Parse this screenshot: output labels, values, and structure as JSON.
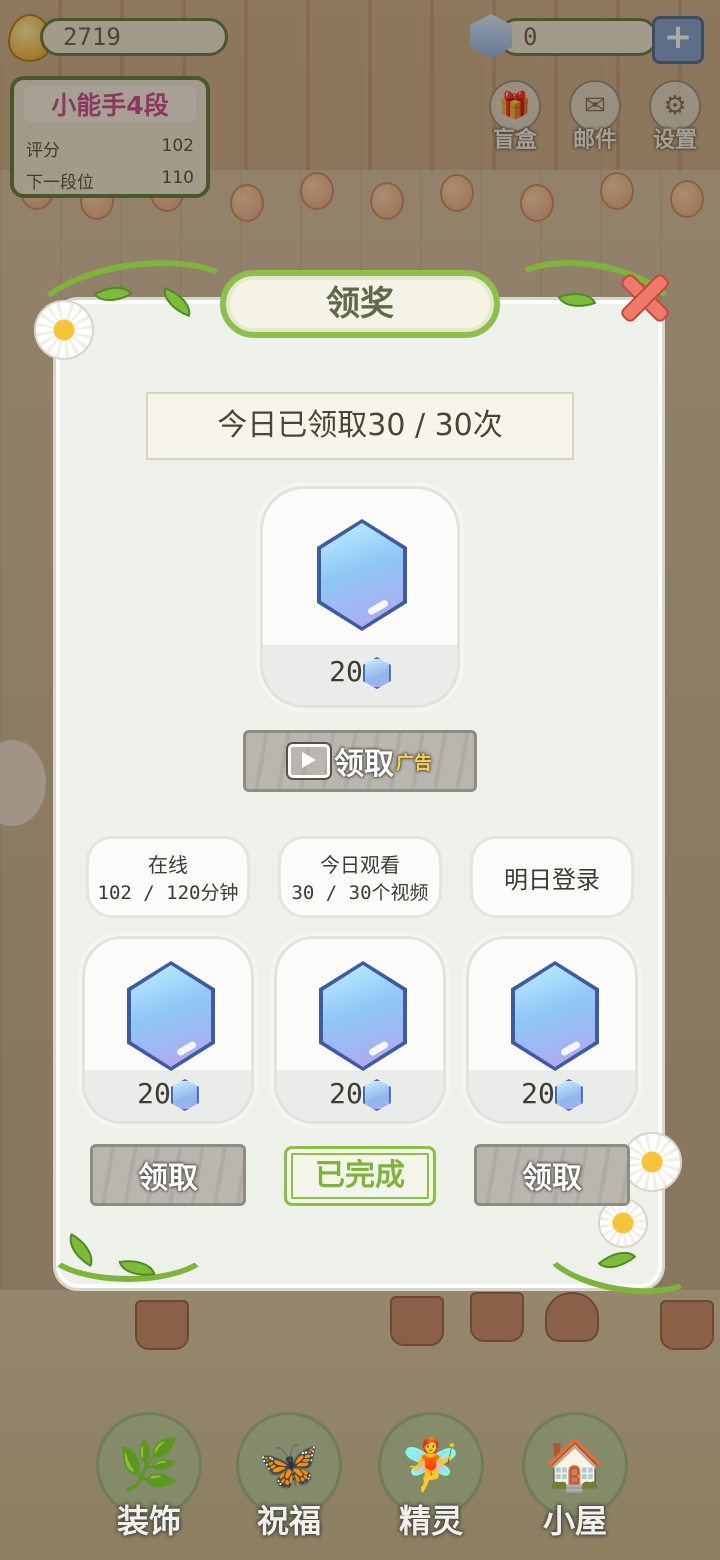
{
  "hud": {
    "coins": "2719",
    "gems": "0",
    "plus_icon": "plus-icon",
    "rank": {
      "title": "小能手4段",
      "score_label": "评分",
      "score_value": "102",
      "next_label": "下一段位",
      "next_value": "110"
    },
    "top_buttons": [
      {
        "label": "盲盒",
        "icon": "gift-box-icon"
      },
      {
        "label": "邮件",
        "icon": "mail-icon"
      },
      {
        "label": "设置",
        "icon": "gear-icon"
      }
    ]
  },
  "modal": {
    "title": "领奖",
    "daily_count": "今日已领取30 / 30次",
    "main_reward": {
      "amount": "20",
      "button_label": "领取",
      "ad_tag": "广告"
    },
    "tasks": [
      {
        "line1": "在线",
        "line2": "102 / 120分钟",
        "amount": "20",
        "button": "领取",
        "state": "claimable"
      },
      {
        "line1": "今日观看",
        "line2": "30 / 30个视频",
        "amount": "20",
        "button": "已完成",
        "state": "done"
      },
      {
        "line1": "明日登录",
        "line2": "",
        "amount": "20",
        "button": "领取",
        "state": "claimable"
      }
    ]
  },
  "nav": [
    {
      "label": "装饰",
      "icon": "plant-icon"
    },
    {
      "label": "祝福",
      "icon": "butterfly-icon"
    },
    {
      "label": "精灵",
      "icon": "fairy-icon"
    },
    {
      "label": "小屋",
      "icon": "house-icon"
    }
  ],
  "colors": {
    "accent_green": "#7fb43c",
    "close_red": "#f07a6a",
    "rank_pink": "#c8488e"
  }
}
